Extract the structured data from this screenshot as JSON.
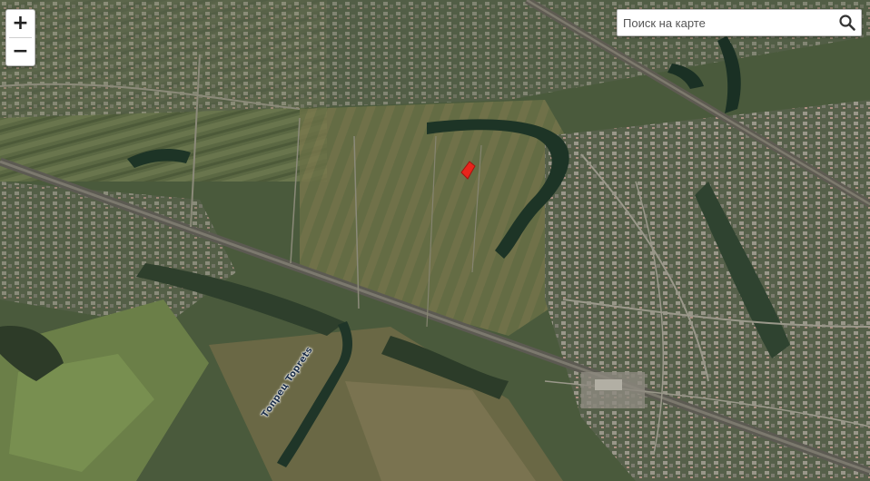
{
  "map": {
    "zoom_in_label": "+",
    "zoom_out_label": "−",
    "search_placeholder": "Поиск на карте",
    "river_label": "Топрец Toprets",
    "marker_color": "#e8251c",
    "search_icon": "magnifier-icon",
    "water_color": "#1d3426"
  }
}
